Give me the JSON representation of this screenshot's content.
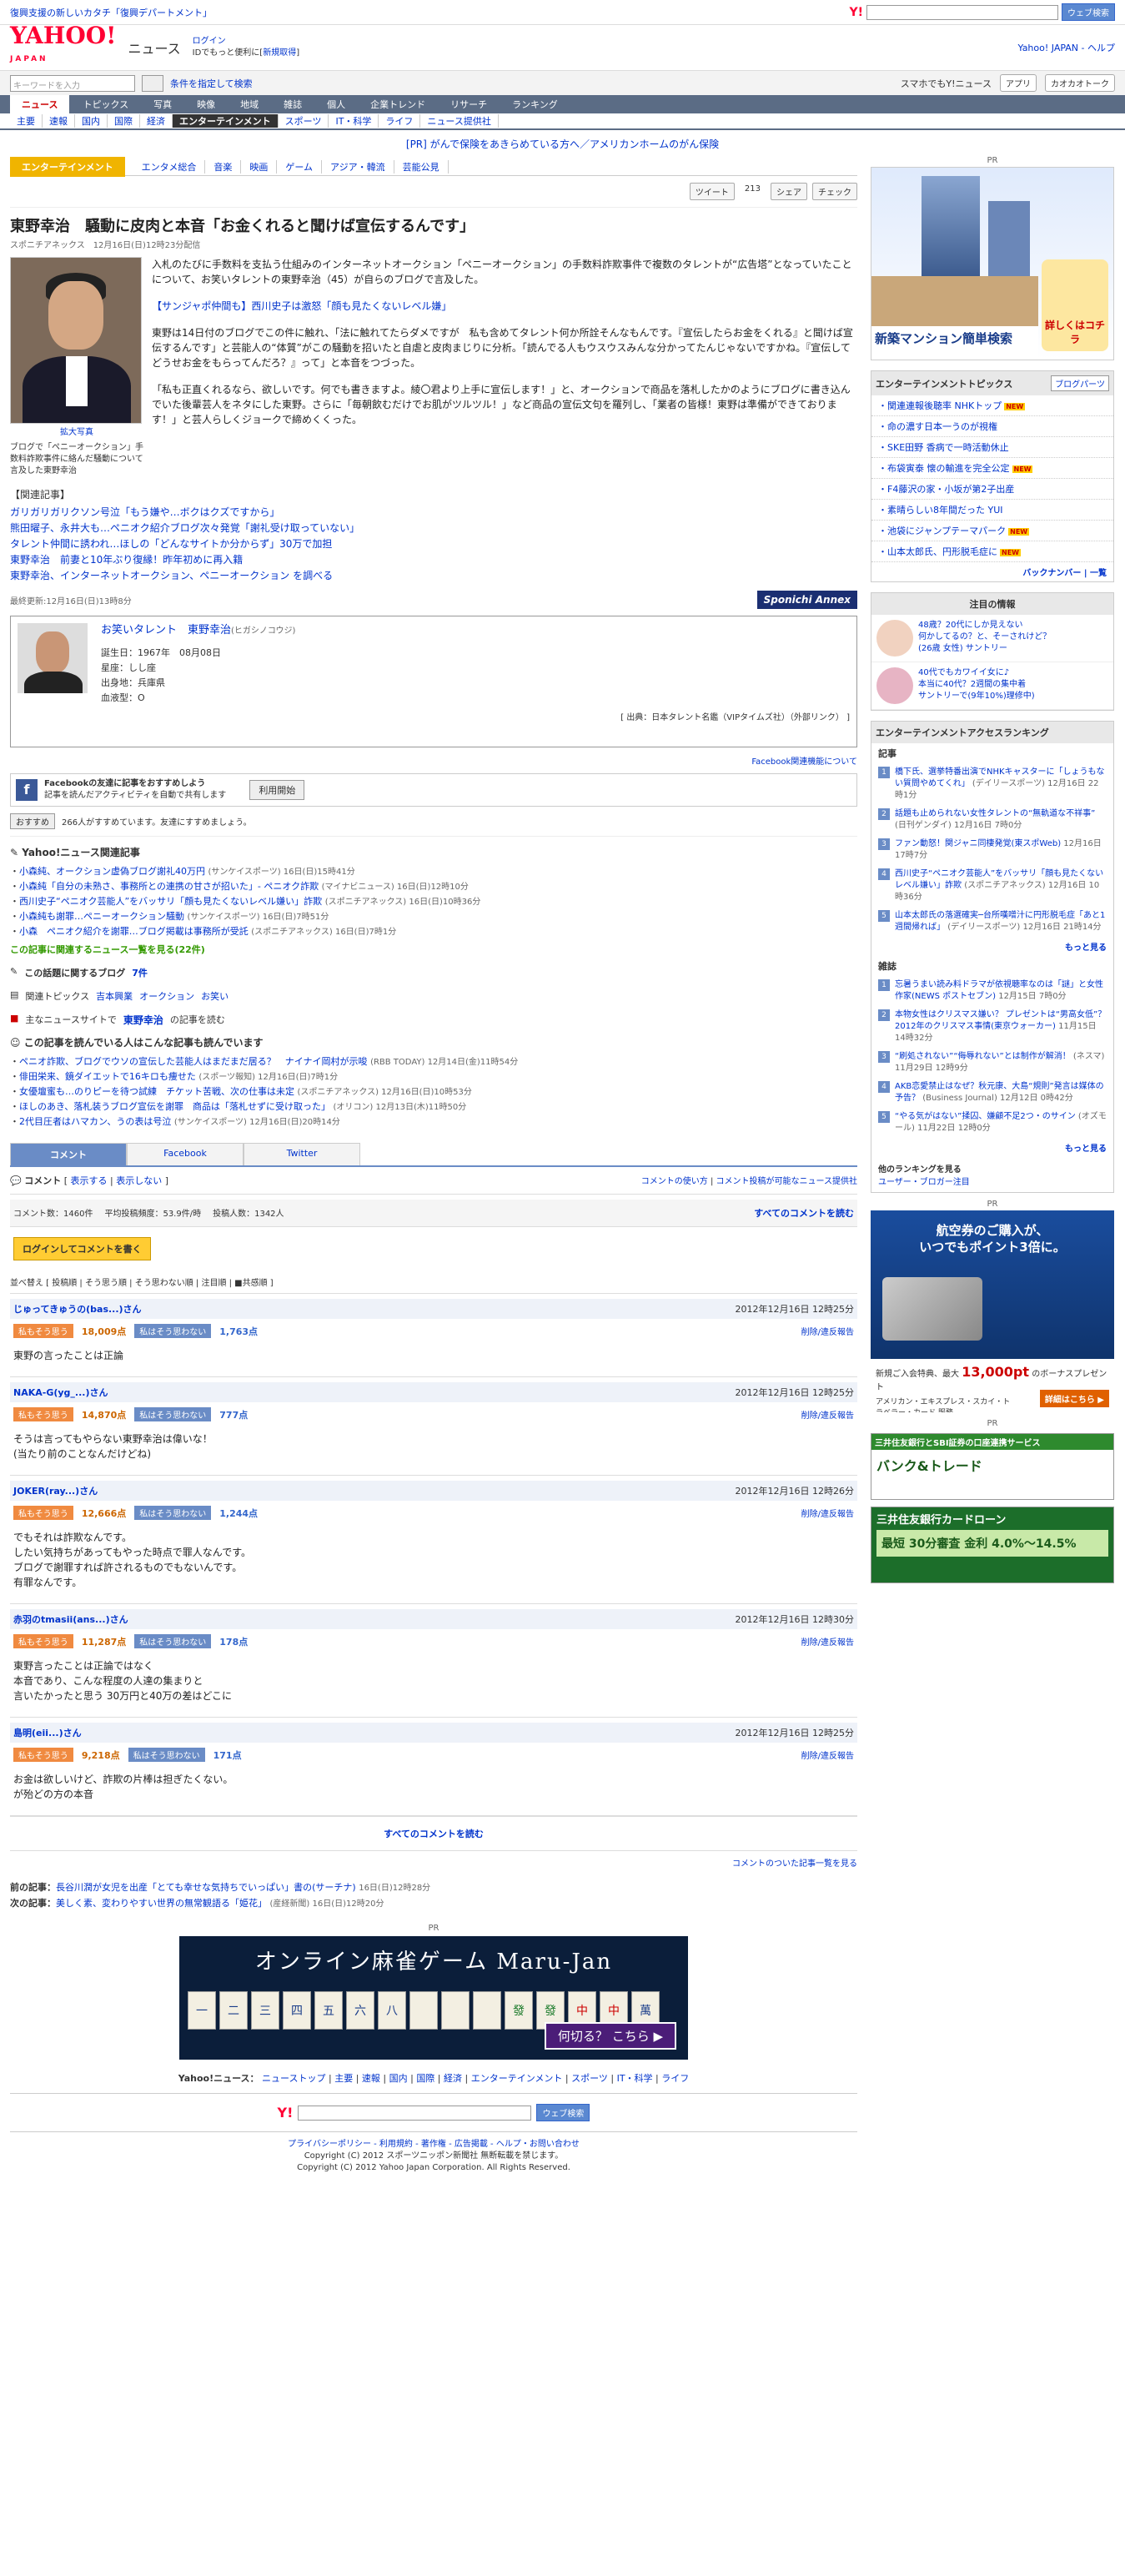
{
  "topbar": {
    "left_link": "復興支援の新しいカタチ「復興デパートメント」",
    "search_btn": "ウェブ検索"
  },
  "header": {
    "logo": "YAHOO!",
    "logo_sub": "JAPAN",
    "service": "ニュース",
    "login": "ログイン",
    "login_sub": "IDでもっと便利に[",
    "register": "新規取得",
    "register_close": "]",
    "right_links": "Yahoo! JAPAN - ヘルプ"
  },
  "search": {
    "placeholder": "キーワードを入力",
    "detail": "条件を指定して検索",
    "mobile": "スマホでもY!ニュース",
    "app": "アプリ",
    "kaokao": "カオカオトーク"
  },
  "nav1": [
    "ニュース",
    "トピックス",
    "写真",
    "映像",
    "地域",
    "雑誌",
    "個人",
    "企業トレンド",
    "リサーチ",
    "ランキング"
  ],
  "nav2": [
    "主要",
    "速報",
    "国内",
    "国際",
    "経済",
    "エンターテインメント",
    "スポーツ",
    "IT・科学",
    "ライフ",
    "ニュース提供社"
  ],
  "pr_text": "[PR] がんで保険をあきらめている方へ／アメリカンホームのがん保険",
  "catbar": {
    "active": "エンターテインメント",
    "items": [
      "エンタメ総合",
      "音楽",
      "映画",
      "ゲーム",
      "アジア・韓流",
      "芸能公見"
    ]
  },
  "social": {
    "tweet": "ツイート",
    "tweet_count": "213",
    "share": "シェア",
    "check": "チェック"
  },
  "article": {
    "title": "東野幸治　騒動に皮肉と本音「お金くれると聞けば宣伝するんです」",
    "source": "スポニチアネックス　12月16日(日)12時23分配信",
    "zoom": "拡大写真",
    "caption": "ブログで「ペニーオークション」手数料詐欺事件に絡んだ騒動について言及した東野幸治",
    "p1": "入札のたびに手数料を支払う仕組みのインターネットオークション「ペニーオークション」の手数料詐欺事件で複数のタレントが“広告塔”となっていたことについて、お笑いタレントの東野幸治（45）が自らのブログで言及した。",
    "p2_link": "【サンジャポ仲間も】西川史子は激怒「顔も見たくないレベル嫌」",
    "p3": "東野は14日付のブログでこの件に触れ、「法に触れてたらダメですが　私も含めてタレント何か所詮そんなもんです。『宣伝したらお金をくれる』と聞けば宣伝するんです」と芸能人の“体質”がこの騒動を招いたと自虐と皮肉まじりに分析。「読んでる人もウスウスみんな分かってたんじゃないですかね。『宣伝してどうせお金をもらってんだろ？』って」と本音をつづった。",
    "p4": "「私も正直くれるなら、欲しいです。何でも書きますよ。綾〇君より上手に宣伝します！」と、オークションで商品を落札したかのようにブログに書き込んでいた後輩芸人をネタにした東野。さらに「毎朝飲むだけでお肌がツルツル！」など商品の宣伝文句を羅列し、「業者の皆様！東野は準備ができております！」と芸人らしくジョークで締めくくった。",
    "related_head": "【関連記事】",
    "related": [
      "ガリガリガリクソン号泣「もう嫌や…ボクはクズですから」",
      "熊田曜子、永井大も…ペニオク紹介ブログ次々発覚「謝礼受け取っていない」",
      "タレント仲間に誘われ…ほしの「どんなサイトか分からず」30万で加担",
      "東野幸治　前妻と10年ぶり復縁！昨年初めに再入籍",
      "東野幸治、インターネットオークション、ペニーオークション を調べる"
    ],
    "updated": "最終更新:12月16日(日)13時8分",
    "sponsor_logo": "Sponichi Annex"
  },
  "talent": {
    "name": "お笑いタレント　東野幸治",
    "kana": "(ヒガシノコウジ)",
    "birth": "誕生日：1967年　08月08日",
    "sign": "星座：しし座",
    "from": "出身地：兵庫県",
    "blood": "血液型：O",
    "src": "[ 出典：日本タレント名鑑（VIPタイムズ社）（外部リンク） ]"
  },
  "fb": {
    "about": "Facebook関連機能について",
    "title": "Facebookの友達に記事をおすすめしよう",
    "desc": "記事を読んだアクティビティを自動で共有します",
    "btn": "利用開始",
    "reco_btn": "おすすめ",
    "reco_text": "266人がすすめています。友達にすすめましょう。"
  },
  "related_news": {
    "head": "Yahoo!ニュース関連記事",
    "items": [
      {
        "t": "小森純、オークション虚偽ブログ謝礼40万円",
        "m": "(サンケイスポーツ) 16日(日)15時41分"
      },
      {
        "t": "小森純「自分の未熟さ、事務所との連携の甘さが招いた」- ペニオク詐欺",
        "m": "(マイナビニュース) 16日(日)12時10分"
      },
      {
        "t": "西川史子“ペニオク芸能人”をバッサリ「顔も見たくないレベル嫌い」詐欺",
        "m": "(スポニチアネックス) 16日(日)10時36分"
      },
      {
        "t": "小森純も謝罪…ペニーオークション騒動",
        "m": "(サンケイスポーツ) 16日(日)7時51分"
      },
      {
        "t": "小森　ペニオク紹介を謝罪…ブログ掲載は事務所が受託",
        "m": "(スポニチアネックス) 16日(日)7時1分"
      }
    ],
    "more": "この記事に関連するニュース一覧を見る(22件)"
  },
  "blog": {
    "label": "この話題に関するブログ",
    "count": "7件"
  },
  "topics": {
    "label": "関連トピックス",
    "items": [
      "吉本興業",
      "オークション",
      "お笑い"
    ]
  },
  "major": {
    "label": "主なニュースサイトで",
    "name": "東野幸治",
    "tail": "の記事を読む"
  },
  "also_read": {
    "head": "この記事を読んでいる人はこんな記事も読んでいます",
    "items": [
      {
        "t": "ペニオ詐欺、ブログでウソの宣伝した芸能人はまだまだ居る？　ナイナイ岡村が示唆",
        "m": "(RBB TODAY) 12月14日(金)11時54分"
      },
      {
        "t": "俳田栄来、鏡ダイエットで16キロも痩せた",
        "m": "(スポーツ報知) 12月16日(日)7時1分"
      },
      {
        "t": "女優壇蜜も…のりピーを待つ試練　チケット苦戦、次の仕事は未定",
        "m": "(スポニチアネックス) 12月16日(日)10時53分"
      },
      {
        "t": "ほしのあき、落札装うブログ宣伝を謝罪　商品は「落札せずに受け取った」",
        "m": "(オリコン) 12月13日(木)11時50分"
      },
      {
        "t": "2代目圧者はハマカン、うの表は号泣",
        "m": "(サンケイスポーツ) 12月16日(日)20時14分"
      }
    ]
  },
  "tabs": [
    "コメント",
    "Facebook",
    "Twitter"
  ],
  "comments": {
    "head": "コメント",
    "show": "表示する",
    "hide": "表示しない",
    "howto": "コメントの使い方",
    "list": "コメント投稿が可能なニュース提供社",
    "count": "コメント数：1460件",
    "avg": "平均投稿頻度：53.9件/時",
    "users": "投稿人数：1342人",
    "all": "すべてのコメントを読む",
    "login": "ログインしてコメントを書く",
    "sort": "並べ替え [ 投稿順 | そう思う順 | そう思わない順 | 注目順 | ■共感順 ]",
    "yes_label": "私もそう思う",
    "no_label": "私はそう思わない",
    "del": "削除/違反報告",
    "items": [
      {
        "u": "じゅってきゅうの(bas...)さん",
        "d": "2012年12月16日 12時25分",
        "y": "18,009点",
        "n": "1,763点",
        "t": "東野の言ったことは正論"
      },
      {
        "u": "NAKA-G(yg_...)さん",
        "d": "2012年12月16日 12時25分",
        "y": "14,870点",
        "n": "777点",
        "t": "そうは言ってもやらない東野幸治は偉いな！\n(当たり前のことなんだけどね)"
      },
      {
        "u": "JOKER(ray...)さん",
        "d": "2012年12月16日 12時26分",
        "y": "12,666点",
        "n": "1,244点",
        "t": "でもそれは詐欺なんです。\nしたい気持ちがあってもやった時点で罪人なんです。\nブログで謝罪すれば許されるものでもないんです。\n有罪なんです。"
      },
      {
        "u": "赤羽のtmasii(ans...)さん",
        "d": "2012年12月16日 12時30分",
        "y": "11,287点",
        "n": "178点",
        "t": "東野言ったことは正論ではなく\n本音であり、こんな程度の人達の集まりと\n言いたかったと思う 30万円と40万の差はどこに"
      },
      {
        "u": "島明(eii...)さん",
        "d": "2012年12月16日 12時25分",
        "y": "9,218点",
        "n": "171点",
        "t": "お金は欲しいけど、詐欺の片棒は担ぎたくない。\nが殆どの方の本音"
      }
    ],
    "all_bottom": "すべてのコメントを読む",
    "list_link": "コメントのついた記事一覧を見る"
  },
  "prevnext": {
    "prev_label": "前の記事：",
    "prev": "長谷川潤が女児を出産「とても幸せな気持ちでいっぱい」書の(サーチナ)",
    "prev_m": "16日(日)12時28分",
    "next_label": "次の記事：",
    "next": "美しく素、変わりやすい世界の無常観語る「姫花」",
    "next_m": "(産経新聞) 16日(日)12時20分"
  },
  "ad_pr": "PR",
  "mahjong": {
    "title": "オンライン麻雀ゲーム Maru-Jan",
    "tiles": [
      "一",
      "二",
      "三",
      "四",
      "五",
      "六",
      "八",
      "",
      "",
      "",
      "發",
      "發",
      "中",
      "中",
      "萬"
    ],
    "btn": "何切る？ こちら ▶"
  },
  "footnav": [
    "Yahoo!ニュース：",
    "ニューストップ",
    "主要",
    "速報",
    "国内",
    "国際",
    "経済",
    "エンターテインメント",
    "スポーツ",
    "IT・科学",
    "ライフ"
  ],
  "foot": {
    "links": "プライバシーポリシー - 利用規約 - 著作権 - 広告掲載 - ヘルプ・お問い合わせ",
    "c1": "Copyright (C) 2012 スポーツニッポン新聞社 無断転載を禁じます。",
    "c2": "Copyright (C) 2012 Yahoo Japan Corporation. All Rights Reserved."
  },
  "right": {
    "pr": "PR",
    "ad1": {
      "text": "新築マンション簡単検索",
      "badge": "詳しくはコチラ"
    },
    "et": {
      "head": "エンターテインメントトピックス",
      "blog": "ブログパーツ",
      "items": [
        "関連連報後聴率 NHKトップ",
        "命の濃す日本一うのが視権",
        "SKE田野 香病で一時活動休止",
        "布袋寅泰 懐の輸進を完全公定",
        "F4藤沢の家・小坂が第2子出産",
        "素晴らしい8年間だった YUI",
        "池袋にジャンプテーマパーク",
        "山本太郎氏、円形脱毛症に"
      ],
      "new": [
        true,
        false,
        false,
        true,
        false,
        false,
        true,
        true
      ],
      "back": "バックナンバー | 一覧"
    },
    "attn": {
      "head": "注目の情報",
      "a1": "48歳？20代にしか見えない\n何かしてるの？と、そーされけど？\n(26歳 女性) サントリー",
      "a2": "40代でもカワイイ女に♪\n本当に40代？2週間の集中着\nサントリーで(9年10%)理修中)"
    },
    "rank": {
      "head": "エンターテインメントアクセスランキング",
      "sub": "記事",
      "items": [
        {
          "n": "1",
          "t": "橋下氏、選挙特番出演でNHKキャスターに「しょうもない質問やめてくれ」",
          "m": "(デイリースポーツ) 12月16日 22時1分"
        },
        {
          "n": "2",
          "t": "話題も止められない女性タレントの“無軌道な不祥事”",
          "m": "(日刊ゲンダイ) 12月16日 7時0分"
        },
        {
          "n": "3",
          "t": "ファン動怒！関ジャニ同棲発覚(東スポWeb)",
          "m": "12月16日 17時7分"
        },
        {
          "n": "4",
          "t": "西川史子“ペニオク芸能人”をバッサリ「顔も見たくないレベル嫌い」詐欺",
          "m": "(スポニチアネックス) 12月16日 10時36分"
        },
        {
          "n": "5",
          "t": "山本太郎氏の落選確実─台所嘆噌汁に円形脱毛症「あと1週間帰れば」",
          "m": "(デイリースポーツ) 12月16日 21時14分"
        }
      ],
      "more": "もっと見る"
    },
    "zasshi": {
      "sub": "雑誌",
      "items": [
        {
          "n": "1",
          "t": "忘暑うまい読み料ドラマが依視聴率なのは「謎」と女性作家(NEWS ポストセブン)",
          "m": "12月15日 7時0分"
        },
        {
          "n": "2",
          "t": "本物女性はクリスマス嫌い？ プレゼントは“男高女低”？ 2012年のクリスマス事情(東京ウォーカー)",
          "m": "11月15日 14時32分"
        },
        {
          "n": "3",
          "t": "“刷処されない”“侮辱れない”とは制作が解消！",
          "m": "(ネスマ) 11月29日 12時9分"
        },
        {
          "n": "4",
          "t": "AKB恋愛禁止はなぜ？秋元康、大島“規則”発言は媒体の予告？",
          "m": "(Business Journal) 12月12日 0時42分"
        },
        {
          "n": "5",
          "t": "“やる気がはない”揉囚、嫌顧不足2つ・のサイン",
          "m": "(オズモール) 11月22日 12時0分"
        }
      ],
      "more": "もっと見る"
    },
    "other": {
      "label": "他のランキングを見る",
      "items": "ユーザー・ブロガー注目"
    },
    "ad2": {
      "t1": "航空券のご購入が、\nいつでもポイント3倍に。",
      "big": "13,000pt",
      "small": "新規ご入会特典、最大",
      "small2": "のボーナスプレゼント",
      "brand": "アメリカン・エキスプレス・スカイ・トラベラー・カード 服務",
      "go": "詳細はこちら ▶"
    },
    "ad3": {
      "hd": "三井住友銀行とSBI証券の口座連携サービス",
      "bd": "バンク&トレード"
    },
    "ad4": {
      "hd": "三井住友銀行カードローン",
      "bd": "最短 30分審査 金利 4.0%～14.5%"
    }
  }
}
